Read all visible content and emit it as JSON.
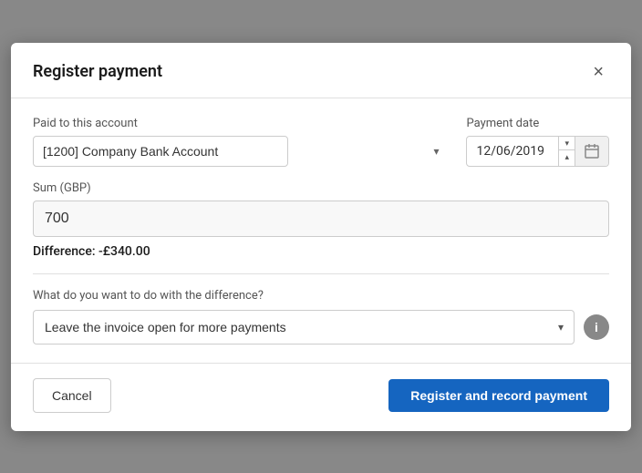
{
  "modal": {
    "title": "Register payment",
    "close_label": "×"
  },
  "form": {
    "account_label": "Paid to this account",
    "account_value": "[1200] Company Bank Account",
    "date_label": "Payment date",
    "date_value": "12/06/2019",
    "sum_label": "Sum (GBP)",
    "sum_value": "700",
    "difference_label": "Difference: -£340.00",
    "diff_question": "What do you want to do with the difference?",
    "diff_option": "Leave the invoice open for more payments",
    "info_label": "i"
  },
  "footer": {
    "cancel_label": "Cancel",
    "register_label": "Register and record payment"
  }
}
